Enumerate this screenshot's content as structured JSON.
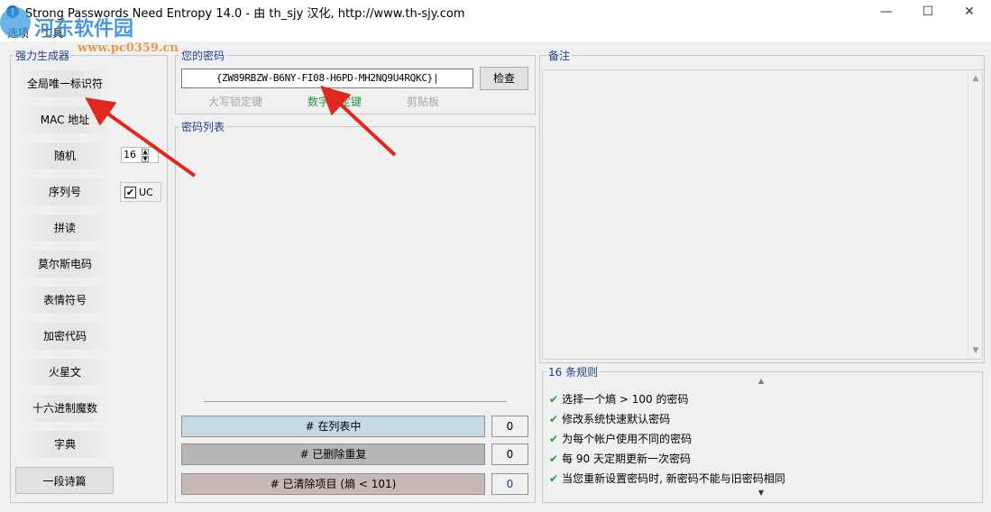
{
  "window": {
    "title": "Strong Passwords Need Entropy 14.0 - 由 th_sjy 汉化, http://www.th-sjy.com",
    "minimize": "—",
    "maximize": "☐",
    "close": "✕"
  },
  "menu": {
    "items": [
      "选项",
      "工具"
    ]
  },
  "watermark": {
    "site_name": "河东软件园",
    "url": "www.pc0359.cn"
  },
  "generator": {
    "legend": "强力生成器",
    "buttons": [
      "全局唯一标识符",
      "MAC 地址",
      "随机",
      "序列号",
      "拼读",
      "莫尔斯电码",
      "表情符号",
      "加密代码",
      "火星文",
      "十六进制魔数",
      "字典",
      "一段诗篇"
    ],
    "length_value": "16",
    "uc_label": "UC",
    "uc_checked": true
  },
  "password": {
    "legend": "您的密码",
    "value": "{ZW89RBZW-B6NY-FI08-H6PD-MH2NQ9U4RQKC}|",
    "check_button": "检查",
    "status": {
      "caps": "大写锁定键",
      "num": "数字锁定键",
      "clipboard": "剪贴板"
    }
  },
  "password_list": {
    "legend": "密码列表",
    "counters": [
      {
        "label": "# 在列表中",
        "value": "0"
      },
      {
        "label": "# 已删除重复",
        "value": "0"
      },
      {
        "label": "# 已清除项目 (熵 < 101)",
        "value": "0"
      }
    ]
  },
  "notes": {
    "legend": "备注"
  },
  "rules": {
    "legend": "16 条规则",
    "items": [
      "选择一个熵 > 100 的密码",
      "修改系统快速默认密码",
      "为每个帐户使用不同的密码",
      "每 90 天定期更新一次密码",
      "当您重新设置密码时, 新密码不能与旧密码相同"
    ]
  },
  "colors": {
    "legend_text": "#1d3f8a",
    "num_lock_active": "#1f9b3c",
    "counter_in_list": "#c4d8e6",
    "counter_removed": "#b6b6b6",
    "counter_cleared": "#c8b8b4",
    "arrow": "#e0281e"
  }
}
